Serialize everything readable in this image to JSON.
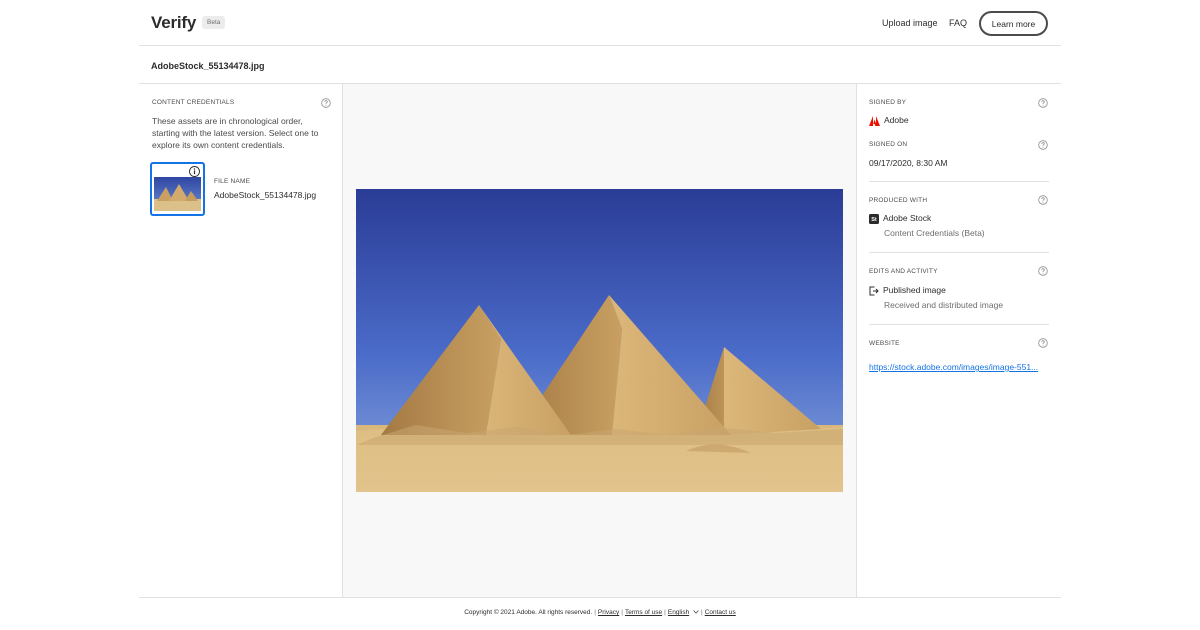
{
  "header": {
    "brand": "Verify",
    "beta_badge": "Beta",
    "nav": {
      "upload_image": "Upload image",
      "faq": "FAQ",
      "learn_more": "Learn more"
    }
  },
  "file": {
    "title": "AdobeStock_55134478.jpg"
  },
  "content_credentials": {
    "heading": "CONTENT CREDENTIALS",
    "description": "These assets are in chronological order, starting with the latest version. Select one to explore its own content credentials.",
    "asset": {
      "label": "FILE NAME",
      "name": "AdobeStock_55134478.jpg"
    }
  },
  "details": {
    "signed_by": {
      "heading": "SIGNED BY",
      "value": "Adobe",
      "icon": "adobe-logo-icon"
    },
    "signed_on": {
      "heading": "SIGNED ON",
      "value": "09/17/2020, 8:30 AM"
    },
    "produced_with": {
      "heading": "PRODUCED WITH",
      "value": "Adobe Stock",
      "sub": "Content Credentials (Beta)",
      "icon": "adobe-stock-icon"
    },
    "edits_activity": {
      "heading": "EDITS AND ACTIVITY",
      "value": "Published image",
      "sub": "Received and distributed image",
      "icon": "publish-icon"
    },
    "website": {
      "heading": "WEBSITE",
      "value": "https://stock.adobe.com/images/image-551..."
    }
  },
  "footer": {
    "copyright": "Copyright © 2021 Adobe. All rights reserved.",
    "privacy": "Privacy",
    "terms": "Terms of use",
    "language": "English",
    "contact": "Contact us"
  },
  "colors": {
    "accent": "#1473e6",
    "adobe_red": "#eb1000",
    "divider": "#e1e1e1"
  }
}
